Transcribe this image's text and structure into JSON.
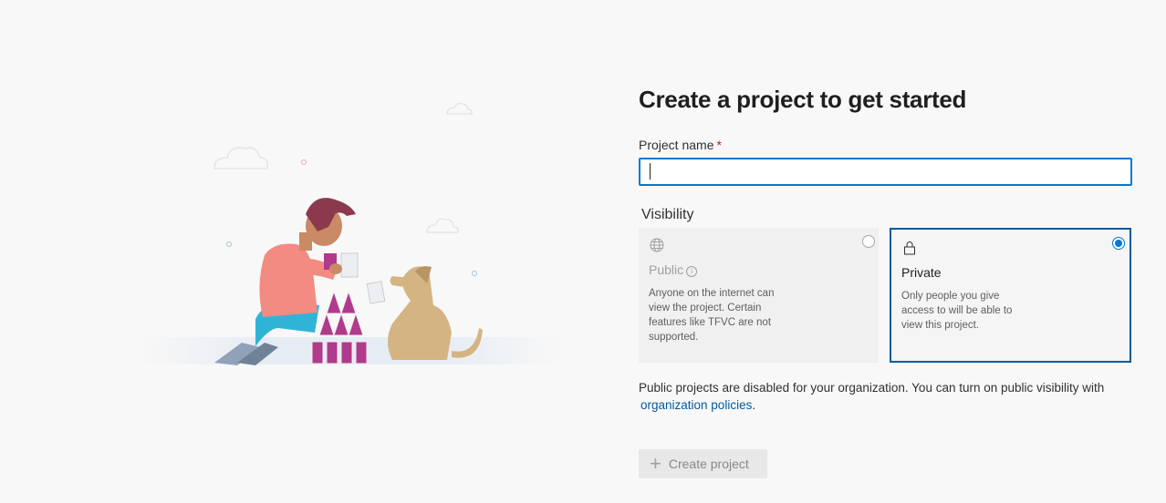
{
  "page": {
    "title": "Create a project to get started"
  },
  "form": {
    "project_name_label": "Project name",
    "required_marker": "*",
    "project_name_value": "",
    "visibility_label": "Visibility"
  },
  "visibility_options": {
    "public": {
      "label": "Public",
      "icon": "globe-icon",
      "description": "Anyone on the internet can view the project. Certain features like TFVC are not supported.",
      "selected": false,
      "disabled": true
    },
    "private": {
      "label": "Private",
      "icon": "lock-icon",
      "description": "Only people you give access to will be able to view this project.",
      "selected": true,
      "disabled": false
    }
  },
  "notice": {
    "text": "Public projects are disabled for your organization. You can turn on public visibility with",
    "link": "organization policies",
    "suffix": "."
  },
  "actions": {
    "create_label": "Create project",
    "create_icon": "plus-icon",
    "create_disabled": true
  },
  "colors": {
    "accent": "#0078d4",
    "selected_border": "#005a9e",
    "link": "#005a9e",
    "required": "#a4262c"
  }
}
